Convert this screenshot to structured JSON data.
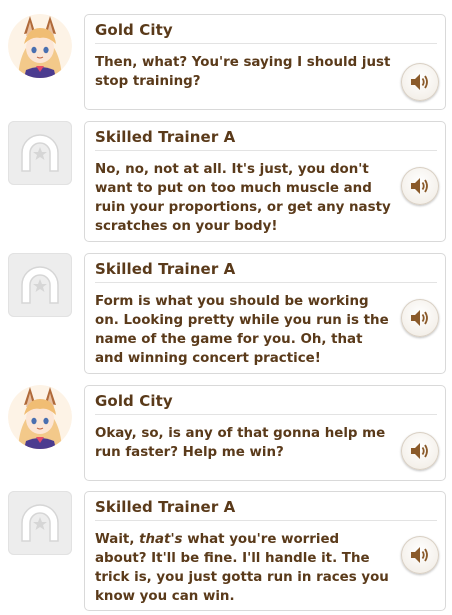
{
  "dialogue_log": [
    {
      "speaker": "Gold City",
      "avatar_icon": "gold-city-portrait",
      "text": "Then, what? You're saying I should just stop training?",
      "voice_icon": "speaker-icon"
    },
    {
      "speaker": "Skilled Trainer A",
      "avatar_icon": "trainer-placeholder-icon",
      "text": "No, no, not at all. It's just, you don't want to put on too much muscle and ruin your proportions, or get any nasty scratches on your body!",
      "voice_icon": "speaker-icon"
    },
    {
      "speaker": "Skilled Trainer A",
      "avatar_icon": "trainer-placeholder-icon",
      "text": "Form is what you should be working on. Looking pretty while you run is the name of the game for you. Oh, that and winning concert practice!",
      "voice_icon": "speaker-icon"
    },
    {
      "speaker": "Gold City",
      "avatar_icon": "gold-city-portrait",
      "text": "Okay, so, is any of that gonna help me run faster? Help me win?",
      "voice_icon": "speaker-icon"
    },
    {
      "speaker": "Skilled Trainer A",
      "avatar_icon": "trainer-placeholder-icon",
      "text_before": "Wait, ",
      "text_emphasis": "that's",
      "text_after": " what you're worried about? It'll be fine. I'll handle it. The trick is, you just gotta run in races you know you can win.",
      "voice_icon": "speaker-icon"
    }
  ],
  "colors": {
    "text": "#5a3a1a",
    "card_border": "#d9d9d9",
    "placeholder_tile": "#ededed",
    "hair": "#f3c98a",
    "ears": "#b06a3a"
  }
}
